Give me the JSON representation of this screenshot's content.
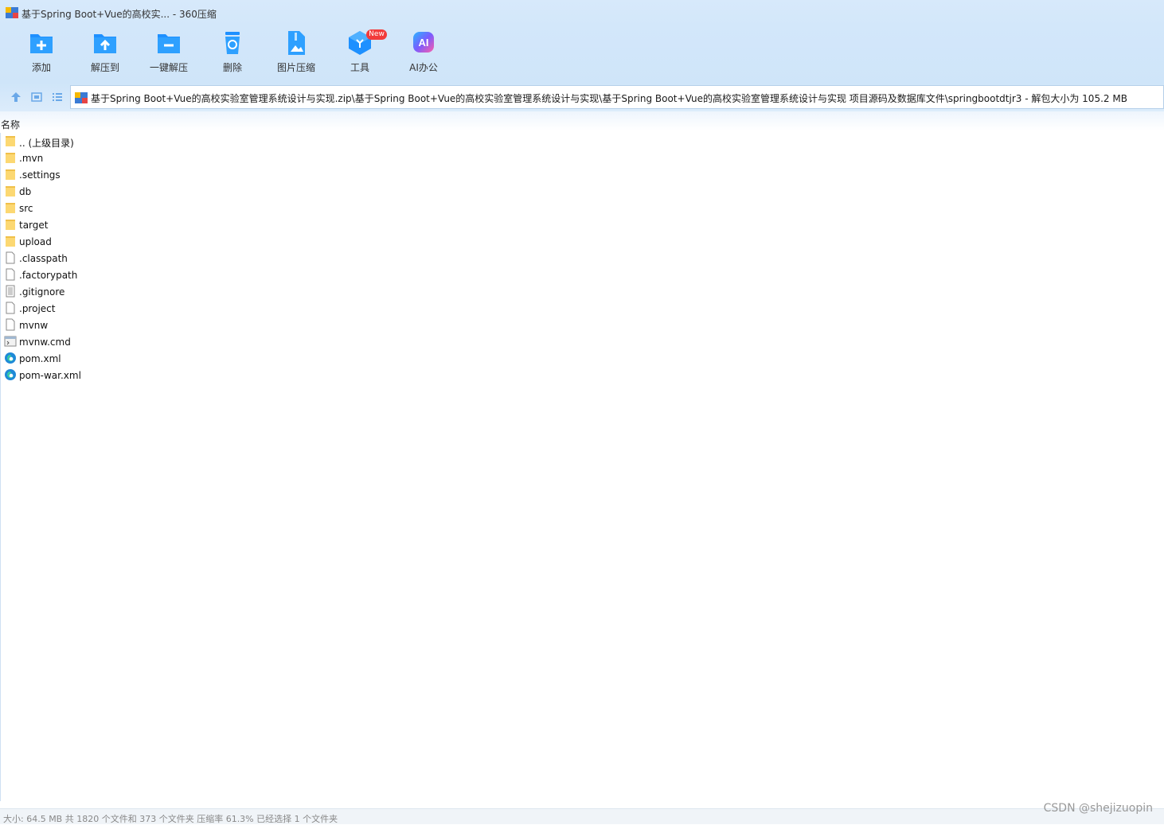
{
  "window": {
    "title": "基于Spring Boot+Vue的高校实... - 360压缩"
  },
  "toolbar": {
    "add": "添加",
    "extract_to": "解压到",
    "one_click_extract": "一键解压",
    "delete": "删除",
    "image_compress": "图片压缩",
    "tools": "工具",
    "tools_badge": "New",
    "ai_office": "AI办公",
    "ai_icon_text": "AI"
  },
  "address": {
    "path": "基于Spring Boot+Vue的高校实验室管理系统设计与实现.zip\\基于Spring Boot+Vue的高校实验室管理系统设计与实现\\基于Spring Boot+Vue的高校实验室管理系统设计与实现 项目源码及数据库文件\\springbootdtjr3 - 解包大小为 105.2 MB"
  },
  "columns": {
    "name": "名称"
  },
  "files": [
    {
      "name": ".. (上级目录)",
      "type": "folder"
    },
    {
      "name": ".mvn",
      "type": "folder"
    },
    {
      "name": ".settings",
      "type": "folder"
    },
    {
      "name": "db",
      "type": "folder"
    },
    {
      "name": "src",
      "type": "folder"
    },
    {
      "name": "target",
      "type": "folder"
    },
    {
      "name": "upload",
      "type": "folder"
    },
    {
      "name": ".classpath",
      "type": "file"
    },
    {
      "name": ".factorypath",
      "type": "file"
    },
    {
      "name": ".gitignore",
      "type": "text"
    },
    {
      "name": ".project",
      "type": "file"
    },
    {
      "name": "mvnw",
      "type": "file"
    },
    {
      "name": "mvnw.cmd",
      "type": "cmd"
    },
    {
      "name": "pom.xml",
      "type": "edge"
    },
    {
      "name": "pom-war.xml",
      "type": "edge"
    }
  ],
  "status": {
    "text": "大小: 64.5 MB 共 1820 个文件和 373 个文件夹 压缩率 61.3% 已经选择 1 个文件夹"
  },
  "watermark": "CSDN @shejizuopin",
  "icons": {
    "folder": "folder-icon",
    "file": "file-icon",
    "text": "text-file-icon",
    "cmd": "cmd-file-icon",
    "edge": "edge-icon"
  },
  "colors": {
    "accent": "#1e90ff",
    "toolbar_bg": "#d3e7fa",
    "badge": "#f23b3b"
  }
}
